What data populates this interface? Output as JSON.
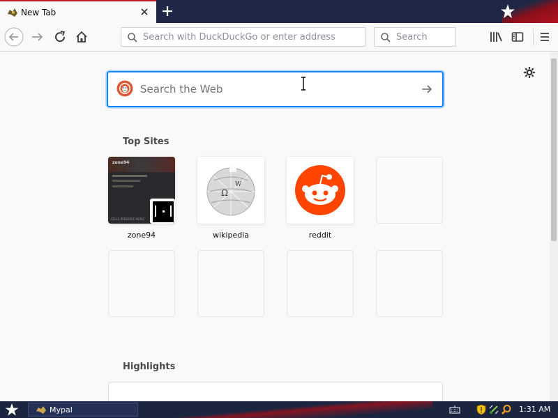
{
  "tab": {
    "title": "New Tab"
  },
  "navbar": {
    "url_placeholder": "Search with DuckDuckGo or enter address",
    "search_placeholder": "Search"
  },
  "newtab": {
    "search_placeholder": "Search the Web",
    "top_sites_title": "Top Sites",
    "highlights_title": "Highlights",
    "top_sites": [
      {
        "label": "zone94"
      },
      {
        "label": "wikipedia"
      },
      {
        "label": "reddit"
      }
    ],
    "zone94_thumb": {
      "heading": "zone94",
      "caption": "CELLS PRESERVE MUSIC"
    }
  },
  "taskbar": {
    "item_label": "Mypal",
    "clock": "1:31 AM"
  },
  "colors": {
    "accent": "#0a84ff",
    "reddit": "#ff4500",
    "taskbar": "#1c2540",
    "tab_border": "#c41b26"
  }
}
